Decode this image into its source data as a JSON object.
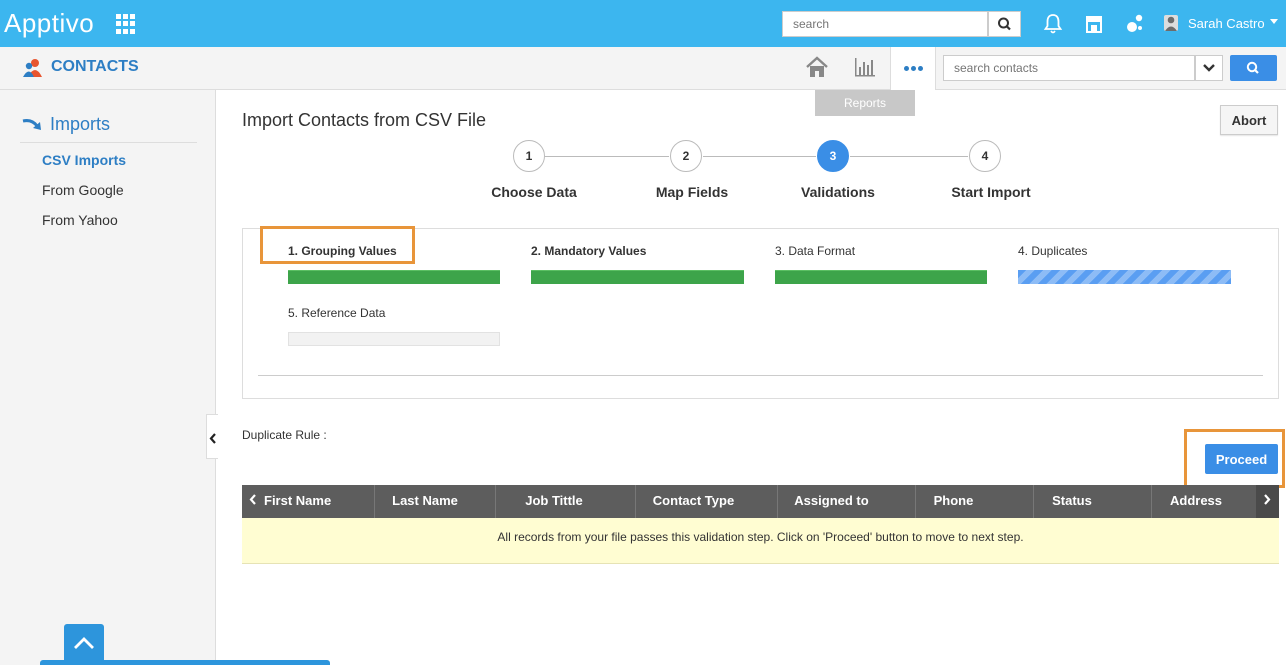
{
  "app": {
    "logo": "Apptivo",
    "search_placeholder": "search",
    "user_name": "Sarah Castro"
  },
  "module": {
    "title": "CONTACTS",
    "search_placeholder": "search contacts",
    "tooltip": "Reports"
  },
  "sidebar": {
    "heading": "Imports",
    "items": [
      {
        "label": "CSV Imports",
        "active": true
      },
      {
        "label": "From Google",
        "active": false
      },
      {
        "label": "From Yahoo",
        "active": false
      }
    ]
  },
  "page": {
    "title": "Import Contacts from CSV File",
    "abort_label": "Abort"
  },
  "wizard": {
    "steps": [
      {
        "number": "1",
        "label": "Choose Data"
      },
      {
        "number": "2",
        "label": "Map Fields"
      },
      {
        "number": "3",
        "label": "Validations",
        "active": true
      },
      {
        "number": "4",
        "label": "Start Import"
      }
    ]
  },
  "validations": [
    {
      "label": "1. Grouping Values",
      "status": "complete",
      "progress": 1.0
    },
    {
      "label": "2. Mandatory Values",
      "status": "complete",
      "progress": 1.0
    },
    {
      "label": "3. Data Format",
      "status": "complete",
      "progress": 1.0
    },
    {
      "label": "4. Duplicates",
      "status": "in-progress",
      "progress": 1.0
    },
    {
      "label": "5. Reference Data",
      "status": "pending",
      "progress": 0.0
    }
  ],
  "duplicate_rule": {
    "label": "Duplicate Rule :"
  },
  "proceed_label": "Proceed",
  "grid": {
    "columns": [
      "First Name",
      "Last Name",
      "Job Tittle",
      "Contact Type",
      "Assigned to",
      "Phone",
      "Status",
      "Address"
    ],
    "message": "All records from your file passes this validation step. Click on 'Proceed' button to move to next step."
  },
  "colors": {
    "topbar": "#3cb6ef",
    "accent": "#3a8ee6",
    "highlight": "#e8953a",
    "bar_complete": "#3da44a"
  }
}
